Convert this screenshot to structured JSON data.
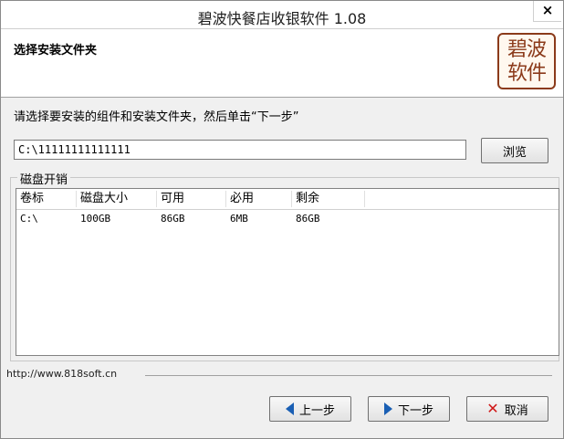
{
  "window": {
    "title": "碧波快餐店收银软件 1.08",
    "close_glyph": "×"
  },
  "header": {
    "title": "选择安装文件夹",
    "logo_line1": "碧波",
    "logo_line2": "软件"
  },
  "instruction": "请选择要安装的组件和安装文件夹，然后单击“下一步”",
  "install_path": {
    "value": "C:\\11111111111111"
  },
  "browse_label": "浏览",
  "disk_group": {
    "label": "磁盘开销",
    "columns": [
      "卷标",
      "磁盘大小",
      "可用",
      "必用",
      "剩余"
    ],
    "rows": [
      [
        "C:\\",
        "100GB",
        "86GB",
        "6MB",
        "86GB"
      ]
    ]
  },
  "footer": {
    "url": "http://www.818soft.cn",
    "prev_label": "上一步",
    "next_label": "下一步",
    "cancel_label": "取消"
  },
  "colors": {
    "accent_arrow": "#1a5fb4",
    "cancel_x": "#d01818",
    "logo": "#8b3a1a"
  },
  "icons": [
    "close-icon",
    "arrow-left-icon",
    "arrow-right-icon",
    "cancel-x-icon"
  ]
}
